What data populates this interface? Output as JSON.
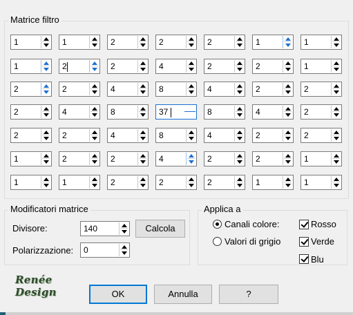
{
  "matrix": {
    "title": "Matrice filtro",
    "rows": [
      [
        "1",
        "1",
        "2",
        "2",
        "2",
        "1",
        "1"
      ],
      [
        "1",
        "2",
        "2",
        "4",
        "2",
        "2",
        "1"
      ],
      [
        "2",
        "2",
        "4",
        "8",
        "4",
        "2",
        "2"
      ],
      [
        "2",
        "4",
        "8",
        "37",
        "8",
        "4",
        "2"
      ],
      [
        "2",
        "2",
        "4",
        "8",
        "4",
        "2",
        "2"
      ],
      [
        "1",
        "2",
        "2",
        "4",
        "2",
        "2",
        "1"
      ],
      [
        "1",
        "1",
        "2",
        "2",
        "2",
        "1",
        "1"
      ]
    ]
  },
  "modifiers": {
    "title": "Modificatori matrice",
    "divisor_label": "Divisore:",
    "divisor_value": "140",
    "calc_button": "Calcola",
    "bias_label": "Polarizzazione:",
    "bias_value": "0"
  },
  "apply": {
    "title": "Applica a",
    "channels_color_label": "Canali colore:",
    "grayscale_label": "Valori di grigio",
    "selected_mode": "Canali colore",
    "red_label": "Rosso",
    "green_label": "Verde",
    "blue_label": "Blu",
    "red_checked": true,
    "green_checked": true,
    "blue_checked": true
  },
  "logo": {
    "text": "Renée Design"
  },
  "buttons": {
    "ok": "OK",
    "cancel": "Annulla",
    "help": "?"
  },
  "colors": {
    "accent": "#0078d7",
    "focus": "#1a6fd1",
    "background": "#f0f0f0"
  }
}
